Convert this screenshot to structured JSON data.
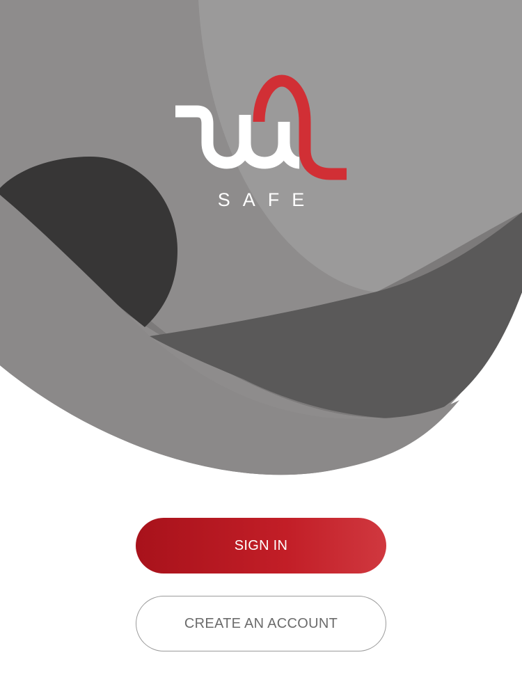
{
  "brand": {
    "name": "SAFE",
    "logo_icon": "wl-monogram-icon",
    "accent_color": "#d12f35"
  },
  "actions": {
    "sign_in_label": "SIGN IN",
    "create_account_label": "CREATE AN ACCOUNT"
  },
  "colors": {
    "primary_start": "#a8121b",
    "primary_end": "#d0383f",
    "background_grey": "#8e8c8c",
    "dark_grey": "#5a5959"
  }
}
